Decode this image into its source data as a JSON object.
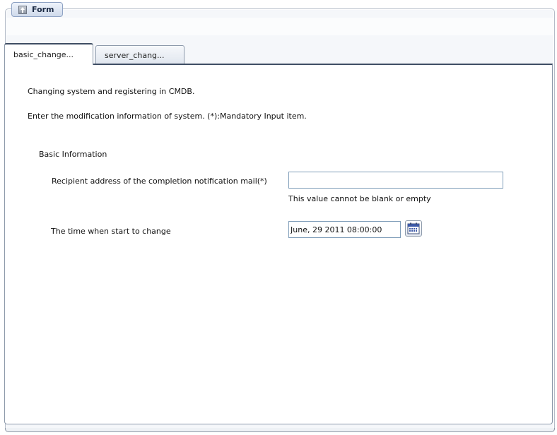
{
  "form": {
    "legend_label": "Form",
    "legend_icon": "collapse-up-icon"
  },
  "tabs": [
    {
      "label": "basic_change...",
      "active": true
    },
    {
      "label": "server_chang...",
      "active": false
    }
  ],
  "content": {
    "intro_line": "Changing system and registering in CMDB.",
    "instruction_line": "Enter the modification information of system. (*):Mandatory Input item.",
    "section_title": "Basic Information",
    "fields": {
      "recipient": {
        "label": "Recipient address of the completion notification mail(*)",
        "value": "",
        "error": "This value cannot be blank or empty"
      },
      "start_time": {
        "label": "The time when start to change",
        "value": "June, 29 2011 08:00:00",
        "button_icon": "calendar-icon"
      }
    }
  },
  "colors": {
    "frame_border": "#b4bcc8",
    "tab_active_top": "#3f4e64",
    "input_border": "#7f9db9",
    "legend_bg": "#cfdaeb"
  }
}
